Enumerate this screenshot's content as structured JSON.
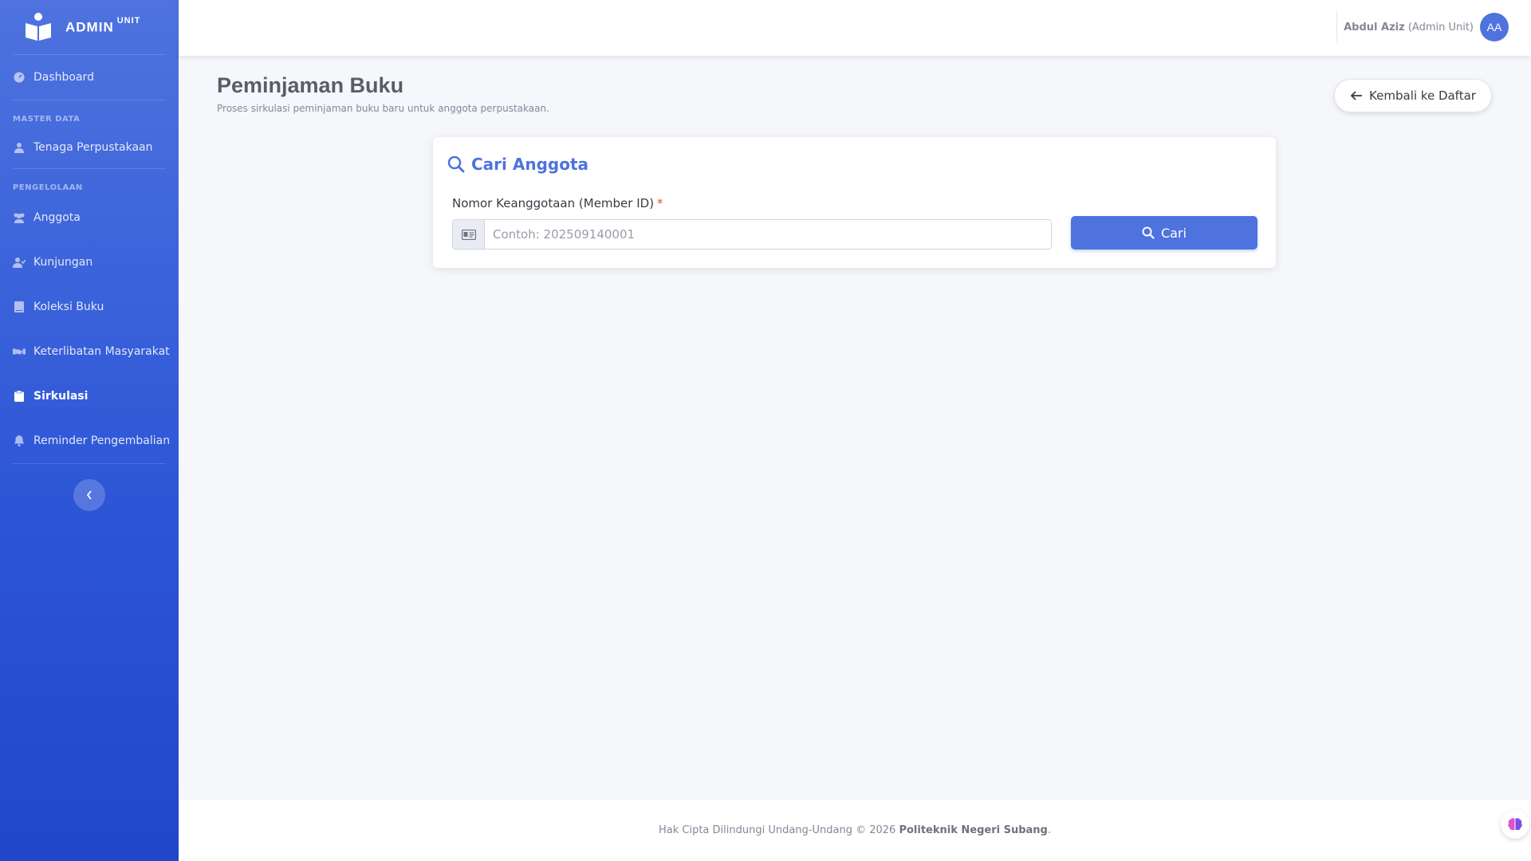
{
  "brand": {
    "name": "ADMIN",
    "suffix": "UNIT",
    "icon": "book-reader-icon"
  },
  "sidebar": {
    "dashboard": {
      "label": "Dashboard",
      "icon": "tachometer-icon"
    },
    "section_master": "MASTER DATA",
    "tenaga": {
      "label": "Tenaga Perpustakaan",
      "icon": "user-icon"
    },
    "section_pengelolaan": "PENGELOLAAN",
    "items": [
      {
        "label": "Anggota",
        "icon": "users-icon"
      },
      {
        "label": "Kunjungan",
        "icon": "user-check-icon"
      },
      {
        "label": "Koleksi Buku",
        "icon": "book-icon"
      },
      {
        "label": "Keterlibatan Masyarakat",
        "icon": "handshake-icon"
      },
      {
        "label": "Sirkulasi",
        "icon": "clipboard-icon",
        "active": true
      },
      {
        "label": "Reminder Pengembalian",
        "icon": "bell-icon"
      }
    ]
  },
  "topbar": {
    "user_name": "Abdul Aziz",
    "user_role": "(Admin Unit)",
    "avatar_initials": "AA"
  },
  "page": {
    "title": "Peminjaman Buku",
    "subtitle": "Proses sirkulasi peminjaman buku baru untuk anggota perpustakaan.",
    "back_label": "Kembali ke Daftar"
  },
  "search_card": {
    "title": "Cari Anggota",
    "field_label": "Nomor Keanggotaan (Member ID)",
    "required_mark": "*",
    "input_value": "",
    "input_placeholder": "Contoh: 202509140001",
    "button_label": "Cari"
  },
  "footer": {
    "text": "Hak Cipta Dilindungi Undang-Undang © 2026",
    "org": "Politeknik Negeri Subang",
    "end": "."
  },
  "colors": {
    "primary": "#4e73df",
    "sidebar_top": "#4e73df",
    "sidebar_bottom": "#2246c9",
    "danger": "#e74a3b"
  }
}
